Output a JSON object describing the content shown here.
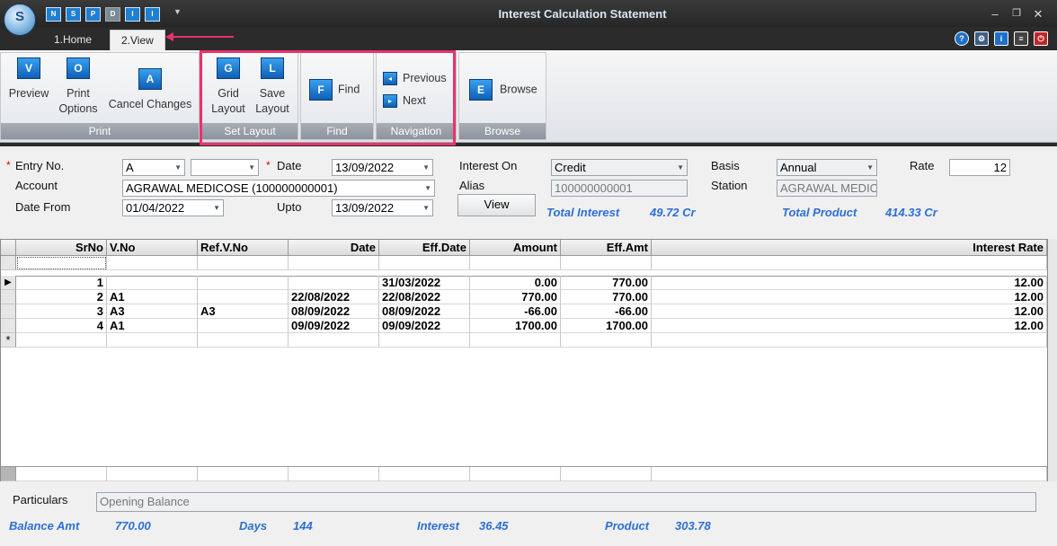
{
  "window": {
    "title": "Interest Calculation Statement",
    "logo_text": "S"
  },
  "quick_access": [
    "N",
    "S",
    "P",
    "D",
    "I",
    "I"
  ],
  "tabs": [
    {
      "label": "1.Home"
    },
    {
      "label": "2.View"
    }
  ],
  "ribbon": {
    "print": {
      "label": "Print",
      "preview": "Preview",
      "print_options_1": "Print",
      "print_options_2": "Options",
      "cancel_changes": "Cancel Changes"
    },
    "set_layout": {
      "label": "Set Layout",
      "grid_layout_1": "Grid",
      "grid_layout_2": "Layout",
      "save_layout_1": "Save",
      "save_layout_2": "Layout"
    },
    "find": {
      "label": "Find",
      "find": "Find"
    },
    "navigation": {
      "label": "Navigation",
      "previous": "Previous",
      "next": "Next"
    },
    "browse": {
      "label": "Browse",
      "browse": "Browse"
    }
  },
  "form": {
    "entry_no_label": "Entry No.",
    "entry_no_value": "A",
    "entry_no_value2": "",
    "date_label": "Date",
    "date_value": "13/09/2022",
    "interest_on_label": "Interest On",
    "interest_on_value": "Credit",
    "basis_label": "Basis",
    "basis_value": "Annual",
    "rate_label": "Rate",
    "rate_value": "12",
    "account_label": "Account",
    "account_value": "AGRAWAL MEDICOSE (100000000001)",
    "alias_label": "Alias",
    "alias_value": "100000000001",
    "station_label": "Station",
    "station_value": "AGRAWAL MEDIC",
    "date_from_label": "Date From",
    "date_from_value": "01/04/2022",
    "upto_label": "Upto",
    "upto_value": "13/09/2022",
    "view_button": "View",
    "total_interest_label": "Total Interest",
    "total_interest_value": "49.72 Cr",
    "total_product_label": "Total Product",
    "total_product_value": "414.33 Cr"
  },
  "grid": {
    "columns": [
      "SrNo",
      "V.No",
      "Ref.V.No",
      "Date",
      "Eff.Date",
      "Amount",
      "Eff.Amt",
      "Interest Rate"
    ],
    "rows": [
      [
        "1",
        "",
        "",
        "",
        "31/03/2022",
        "0.00",
        "770.00",
        "12.00"
      ],
      [
        "2",
        "A1",
        "",
        "22/08/2022",
        "22/08/2022",
        "770.00",
        "770.00",
        "12.00"
      ],
      [
        "3",
        "A3",
        "A3",
        "08/09/2022",
        "08/09/2022",
        "-66.00",
        "-66.00",
        "12.00"
      ],
      [
        "4",
        "A1",
        "",
        "09/09/2022",
        "09/09/2022",
        "1700.00",
        "1700.00",
        "12.00"
      ]
    ]
  },
  "footer": {
    "particulars_label": "Particulars",
    "particulars_value": "Opening Balance",
    "balance_amt_label": "Balance Amt",
    "balance_amt_value": "770.00",
    "days_label": "Days",
    "days_value": "144",
    "interest_label": "Interest",
    "interest_value": "36.45",
    "product_label": "Product",
    "product_value": "303.78"
  }
}
